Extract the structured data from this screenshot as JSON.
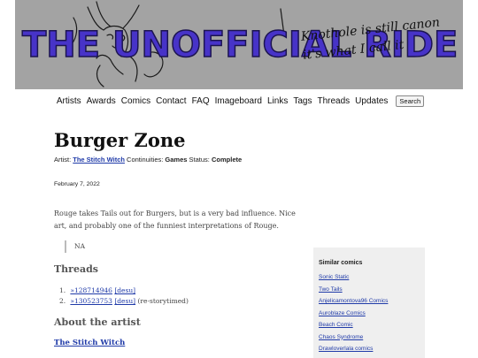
{
  "banner": {
    "title": "THE UNOFFICIAL RIDE",
    "handwriting": "Knothole is still canon\nit's what I call it"
  },
  "nav": {
    "items": [
      "Artists",
      "Awards",
      "Comics",
      "Contact",
      "FAQ",
      "Imageboard",
      "Links",
      "Tags",
      "Threads",
      "Updates"
    ],
    "search_label": "Search"
  },
  "comic": {
    "title": "Burger Zone",
    "artist_label": "Artist:",
    "artist": "The Stitch Witch",
    "continuities_label": "Continuities:",
    "continuities": "Games",
    "status_label": "Status:",
    "status": "Complete",
    "date": "February 7, 2022",
    "description": "Rouge takes Tails out for Burgers, but is a very bad influence. Nice art, and probably one of the funniest interpretations of Rouge.",
    "quote": "NA"
  },
  "threads": {
    "heading": "Threads",
    "items": [
      {
        "num": "1.",
        "link": "»128714946",
        "desu": "[desu]",
        "note": ""
      },
      {
        "num": "2.",
        "link": "»130523753",
        "desu": "[desu]",
        "note": "(re-storytimed)"
      }
    ]
  },
  "about": {
    "heading": "About the artist",
    "artist_link": "The Stitch Witch"
  },
  "sidebar": {
    "heading": "Similar comics",
    "items": [
      "Sonic Static",
      "Two Tails",
      "Anjelicamontova96 Comics",
      "Auroblaze Comics",
      "Beach Comic",
      "Chaos Syndrome",
      "Drawloverlala comics"
    ]
  }
}
